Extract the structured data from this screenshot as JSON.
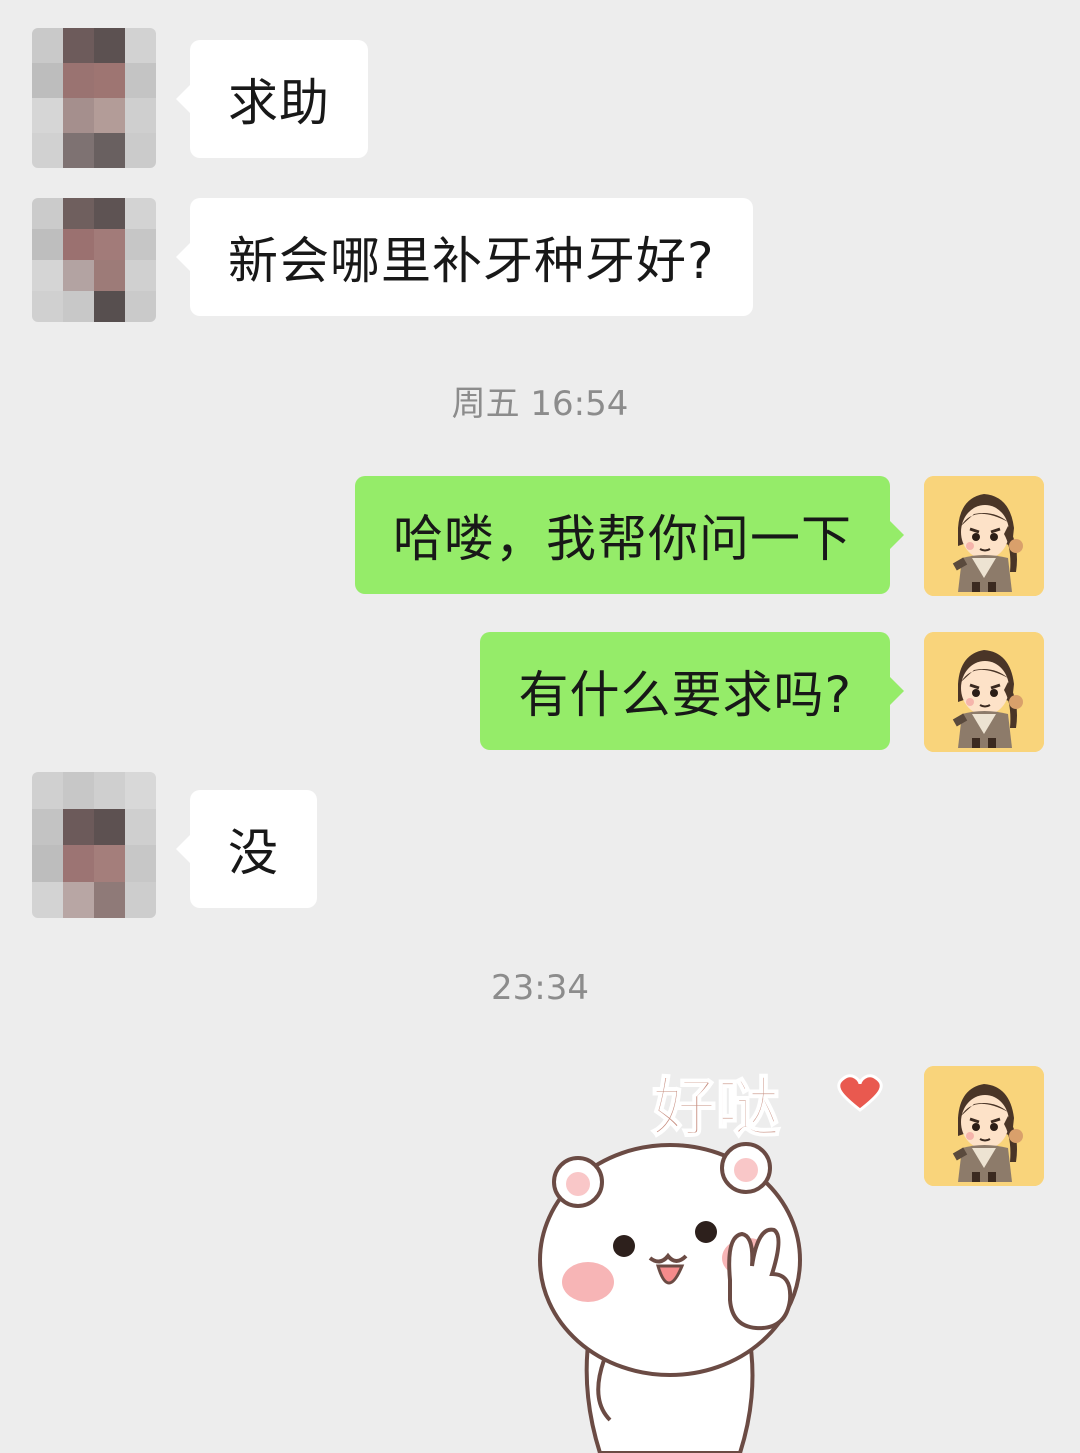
{
  "messages": [
    {
      "text": "求助"
    },
    {
      "text": "新会哪里补牙种牙好?"
    },
    {
      "timestamp": "周五 16:54"
    },
    {
      "text": "哈喽，我帮你问一下"
    },
    {
      "text": "有什么要求吗?"
    },
    {
      "text": "没"
    },
    {
      "timestamp": "23:34"
    }
  ],
  "sticker": {
    "text": "好哒",
    "icon": "bear-peace-sign-sticker"
  },
  "colors": {
    "background": "#ededed",
    "incoming_bubble": "#ffffff",
    "outgoing_bubble": "#95ec69",
    "timestamp": "#8c8c8c",
    "self_avatar_bg": "#f9d47b"
  }
}
